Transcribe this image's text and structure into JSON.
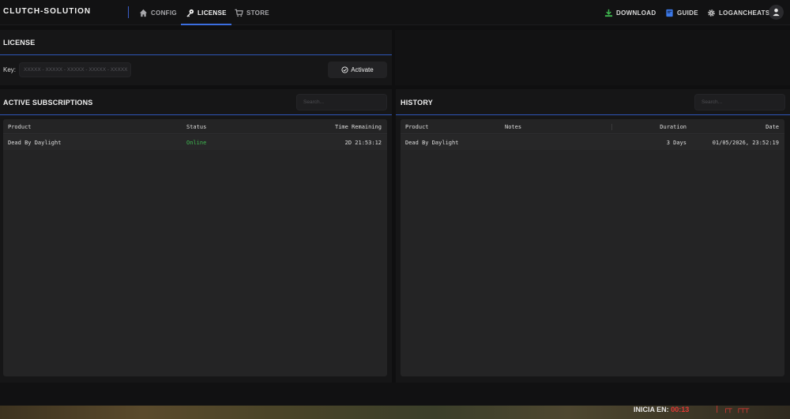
{
  "app": {
    "brand": "CLUTCH-SOLUTION"
  },
  "nav": {
    "config": "CONFIG",
    "license": "LICENSE",
    "store": "STORE",
    "download": "DOWNLOAD",
    "guide": "GUIDE",
    "user": "LOGANCHEATS",
    "accent_color": "#3b6ee0"
  },
  "license": {
    "title": "LICENSE",
    "key_label": "Key:",
    "key_placeholder": "XXXXX - XXXXX - XXXXX - XXXXX - XXXXX",
    "activate_label": "Activate"
  },
  "subscriptions": {
    "title": "ACTIVE SUBSCRIPTIONS",
    "search_placeholder": "Search...",
    "columns": [
      "Product",
      "Status",
      "Time Remaining"
    ],
    "rows": [
      {
        "product": "Dead By Daylight",
        "status": "Online",
        "time_remaining": "2D 21:53:12"
      }
    ],
    "status_color": "#3fb950"
  },
  "history": {
    "title": "HISTORY",
    "search_placeholder": "Search...",
    "columns": [
      "Product",
      "Notes",
      "Duration",
      "Date"
    ],
    "rows": [
      {
        "product": "Dead By Daylight",
        "notes": "",
        "duration": "3 Days",
        "date": "01/05/2026, 23:52:19"
      }
    ]
  },
  "overlay": {
    "inicia_label": "INICIA EN:",
    "inicia_time": "00:13",
    "glyphs": "| ┌┬ ┌┬┬"
  }
}
